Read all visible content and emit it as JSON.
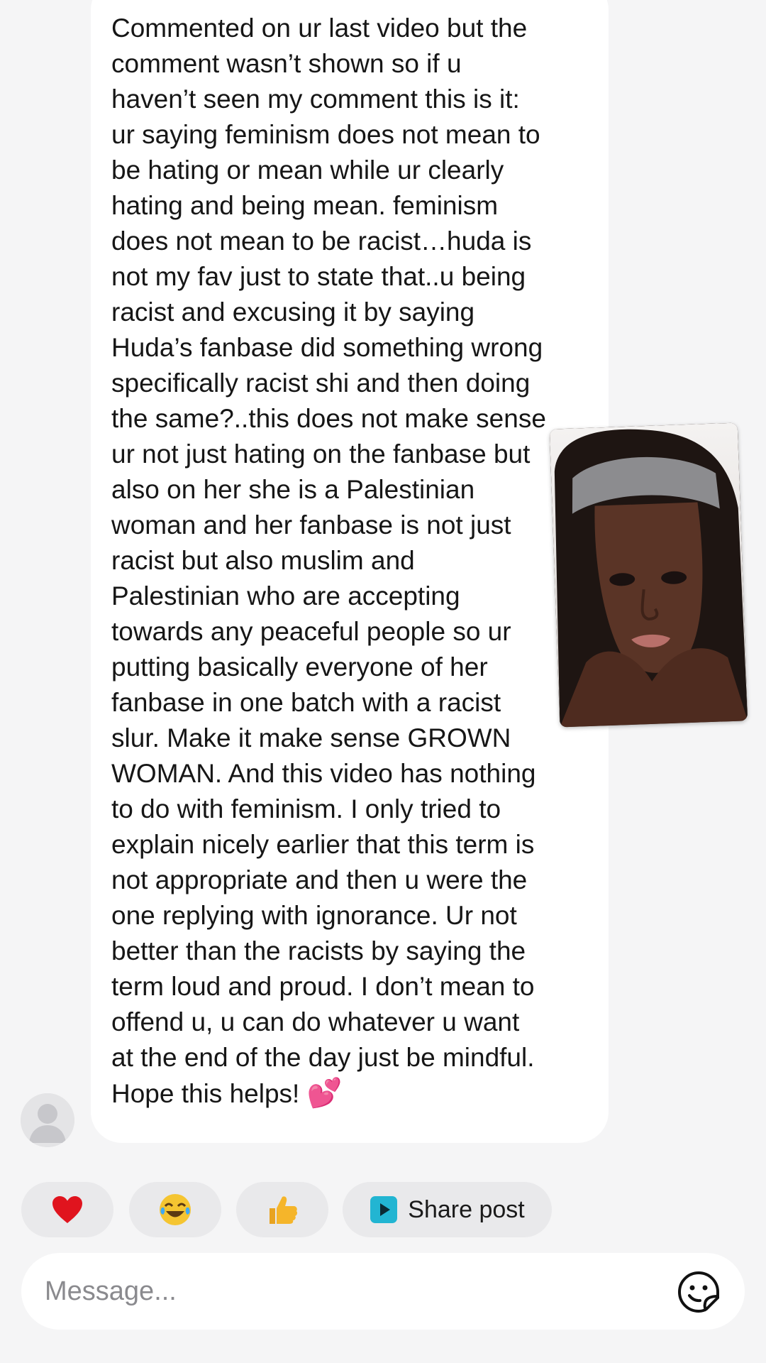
{
  "thread": {
    "message": {
      "text": "Commented on ur last video but the\ncomment wasn’t shown so if u\nhaven’t seen my comment this is it:\nur saying feminism does not mean to\nbe hating or mean while ur clearly\nhating and being mean. feminism\ndoes not mean to be racist…huda is\nnot my fav just to state that..u being\nracist and excusing it by saying\nHuda’s fanbase did something wrong\nspecifically racist shi and then doing\nthe same?..this does not make sense\nur not just hating on the fanbase but\nalso on her she is a Palestinian\nwoman and her fanbase is not just\nracist but also muslim and\nPalestinian who are accepting\ntowards any peaceful people so ur\nputting basically everyone of her\nfanbase in one batch with a racist\nslur. Make it make sense GROWN\nWOMAN. And this video has nothing\nto do with feminism. I only tried to\nexplain nicely earlier that this term is\nnot appropriate and then u were the\none replying with ignorance. Ur not\nbetter than the racists by saying the\nterm loud and proud. I don’t mean to\noffend u, u can do whatever u want\nat the end of the day just be mindful.\nHope this helps!",
      "emoji": "💕"
    },
    "sender_avatar_icon": "default-avatar-icon",
    "overlay_icon": "creator-face-cutout"
  },
  "quick_reactions": {
    "heart": "❤",
    "laugh": "😂",
    "thumbs_up": "👍",
    "share_icon": "play-square-icon",
    "share_label": "Share post",
    "colors": {
      "heart": "#e0141e",
      "laugh": "#f5c531",
      "thumbs_up": "#f5b52a",
      "share_icon": "#22b5d2"
    }
  },
  "composer": {
    "placeholder": "Message...",
    "sticker_icon": "sticker-smiley-icon"
  }
}
